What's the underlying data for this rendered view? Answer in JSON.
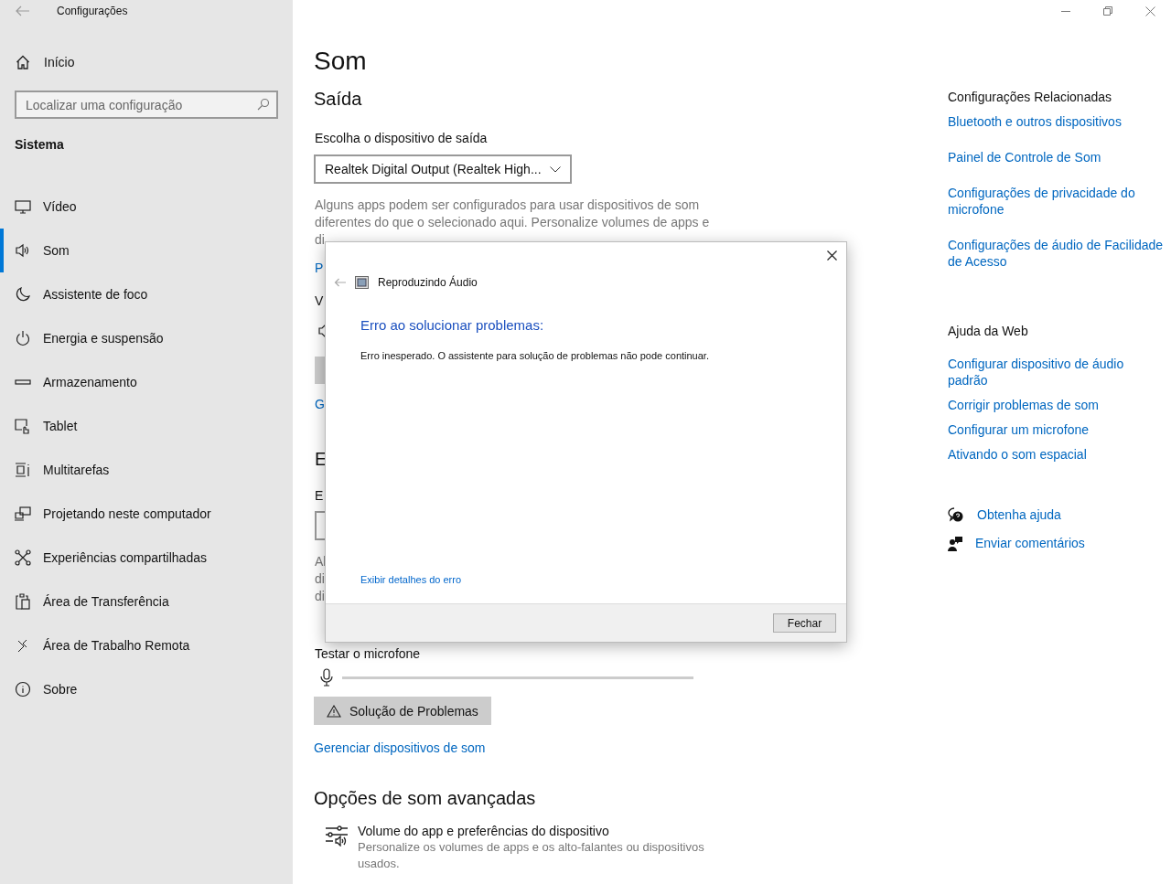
{
  "window": {
    "title": "Configurações"
  },
  "sidebar": {
    "home": "Início",
    "search": {
      "placeholder": "Localizar uma configuração"
    },
    "section": "Sistema",
    "items": [
      {
        "label": "Vídeo",
        "selected": false
      },
      {
        "label": "Som",
        "selected": true
      },
      {
        "label": "Assistente de foco",
        "selected": false
      },
      {
        "label": "Energia e suspensão",
        "selected": false
      },
      {
        "label": "Armazenamento",
        "selected": false
      },
      {
        "label": "Tablet",
        "selected": false
      },
      {
        "label": "Multitarefas",
        "selected": false
      },
      {
        "label": "Projetando neste computador",
        "selected": false
      },
      {
        "label": "Experiências compartilhadas",
        "selected": false
      },
      {
        "label": "Área de Transferência",
        "selected": false
      },
      {
        "label": "Área de Trabalho Remota",
        "selected": false
      },
      {
        "label": "Sobre",
        "selected": false
      }
    ]
  },
  "main": {
    "title": "Som",
    "output": {
      "heading": "Saída",
      "device_label": "Escolha o dispositivo de saída",
      "device_value": "Realtek Digital Output (Realtek High...",
      "description": "Alguns apps podem ser configurados para usar dispositivos de som diferentes do que o selecionado aqui. Personalize volumes de apps e"
    },
    "covered_fragments": [
      {
        "kind": "text",
        "text": "di"
      },
      {
        "kind": "link",
        "text": "P"
      },
      {
        "kind": "label",
        "text": "V"
      },
      {
        "kind": "speaker"
      },
      {
        "kind": "slider"
      },
      {
        "kind": "link",
        "text": "G"
      },
      {
        "kind": "heading",
        "text": "E"
      },
      {
        "kind": "label",
        "text": "E"
      },
      {
        "kind": "dropdown"
      },
      {
        "kind": "text",
        "text": "Al"
      },
      {
        "kind": "text",
        "text": "di"
      },
      {
        "kind": "text",
        "text": "di"
      }
    ],
    "mic_test": {
      "label": "Testar o microfone"
    },
    "troubleshoot_button": "Solução de Problemas",
    "manage_link": "Gerenciar dispositivos de som",
    "advanced": {
      "heading": "Opções de som avançadas",
      "item_title": "Volume do app e preferências do dispositivo",
      "item_description": "Personalize os volumes de apps e os alto-falantes ou dispositivos usados."
    }
  },
  "related": {
    "heading": "Configurações Relacionadas",
    "links": [
      "Bluetooth e outros dispositivos",
      "Painel de Controle de Som",
      "Configurações de privacidade do microfone",
      "Configurações de áudio de Facilidade de Acesso"
    ]
  },
  "web_help": {
    "heading": "Ajuda da Web",
    "links": [
      "Configurar dispositivo de áudio padrão",
      "Corrigir problemas de som",
      "Configurar um microfone",
      "Ativando o som espacial"
    ]
  },
  "support": [
    {
      "kind": "help",
      "label": "Obtenha ajuda"
    },
    {
      "kind": "feedback",
      "label": "Enviar comentários"
    }
  ],
  "dialog": {
    "title": "Reproduzindo Áudio",
    "heading": "Erro ao solucionar problemas:",
    "message": "Erro inesperado. O assistente para solução de problemas não pode continuar.",
    "details_link": "Exibir detalhes do erro",
    "close_button": "Fechar"
  }
}
